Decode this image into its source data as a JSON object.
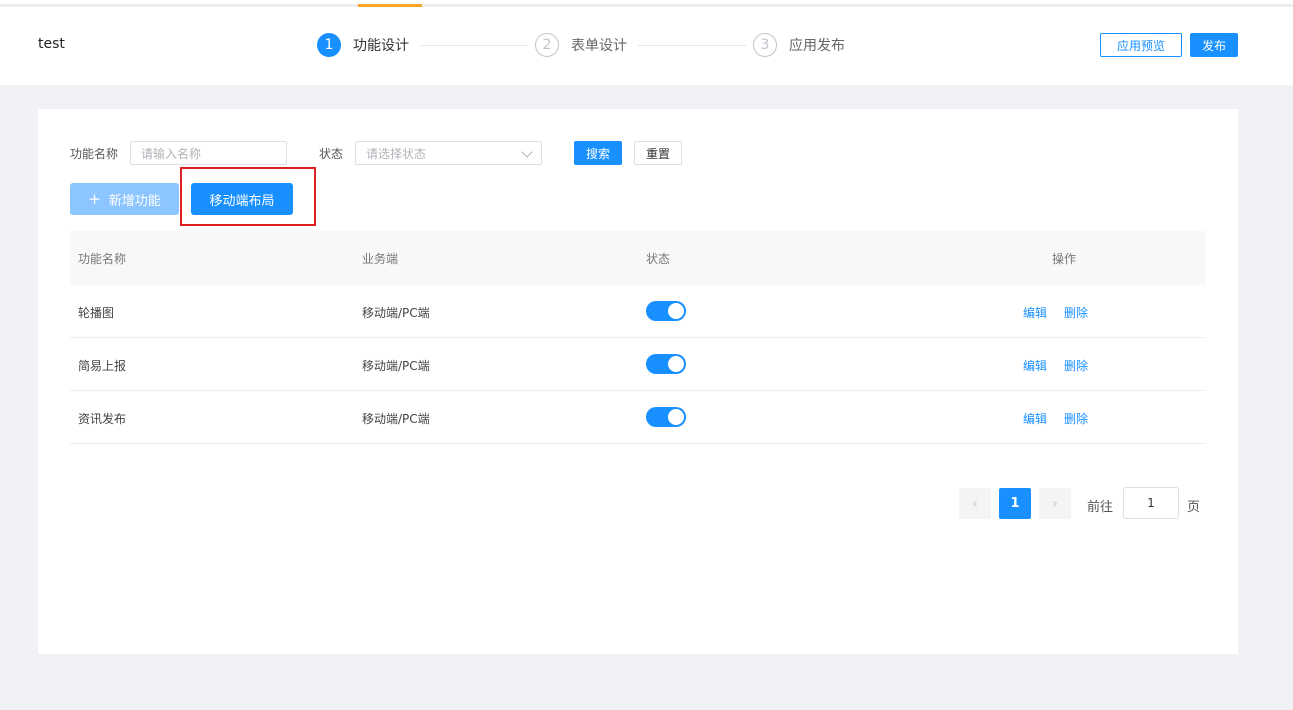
{
  "header": {
    "app_title": "test",
    "steps": [
      {
        "num": "1",
        "label": "功能设计"
      },
      {
        "num": "2",
        "label": "表单设计"
      },
      {
        "num": "3",
        "label": "应用发布"
      }
    ],
    "preview_label": "应用预览",
    "publish_label": "发布"
  },
  "filters": {
    "name_label": "功能名称",
    "name_placeholder": "请输入名称",
    "status_label": "状态",
    "status_placeholder": "请选择状态",
    "search_label": "搜索",
    "reset_label": "重置"
  },
  "actions": {
    "add_label": "新增功能",
    "add_icon": "+",
    "mobile_layout_label": "移动端布局"
  },
  "table": {
    "columns": [
      "功能名称",
      "业务端",
      "状态",
      "操作"
    ],
    "rows": [
      {
        "name": "轮播图",
        "platform": "移动端/PC端",
        "enabled": true
      },
      {
        "name": "简易上报",
        "platform": "移动端/PC端",
        "enabled": true
      },
      {
        "name": "资讯发布",
        "platform": "移动端/PC端",
        "enabled": true
      }
    ],
    "edit_label": "编辑",
    "delete_label": "删除"
  },
  "pagination": {
    "prev_icon": "‹",
    "next_icon": "›",
    "current_page": "1",
    "goto_label": "前往",
    "goto_value": "1",
    "page_suffix": "页"
  },
  "colors": {
    "primary": "#1890ff",
    "accent": "#f5a623",
    "highlight": "#e02020"
  }
}
